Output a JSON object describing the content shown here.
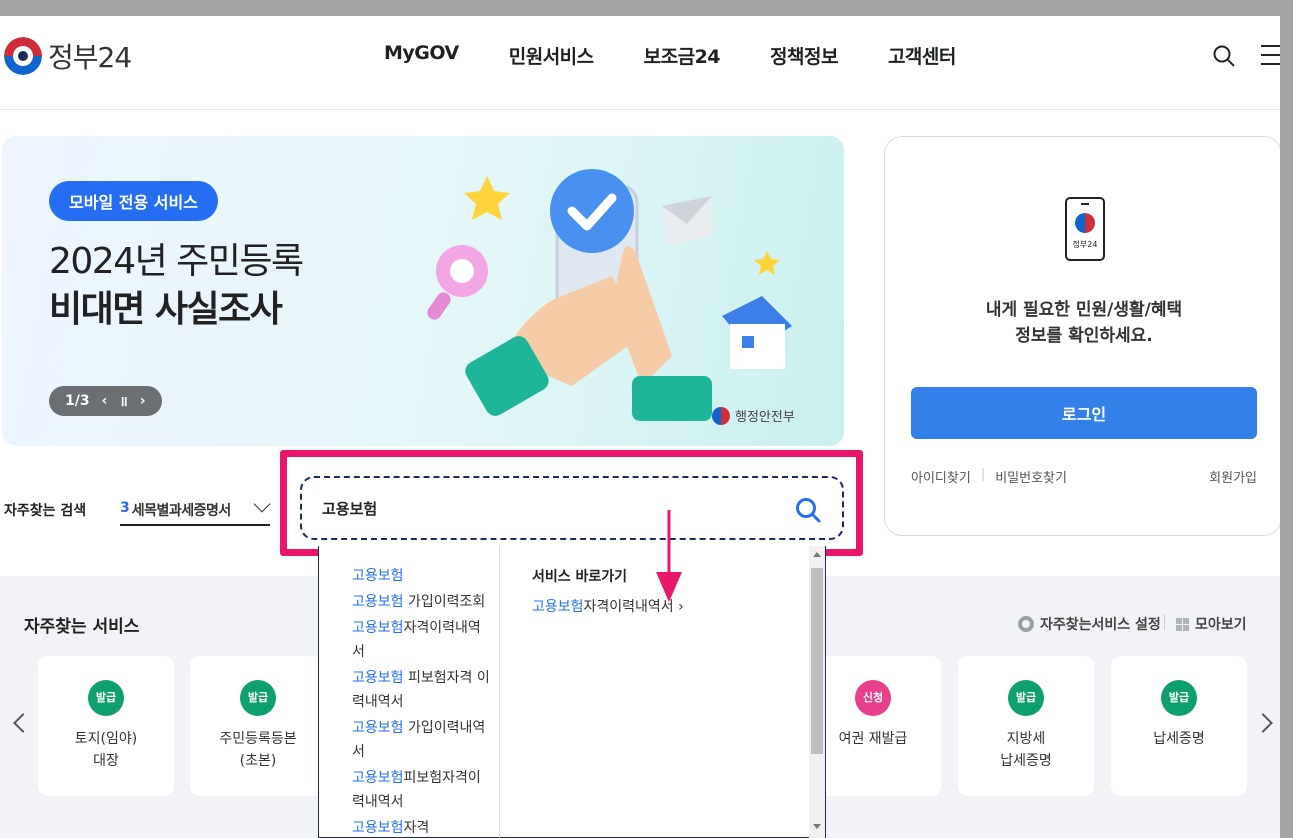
{
  "header": {
    "logo_text": "정부24",
    "nav": [
      "MyGOV",
      "민원서비스",
      "보조금24",
      "정책정보",
      "고객센터"
    ]
  },
  "banner": {
    "badge": "모바일 전용 서비스",
    "line1": "2024년 주민등록",
    "line2": "비대면 사실조사",
    "pager": "1/3",
    "ministry": "행정안전부"
  },
  "login": {
    "phone_label": "정부24",
    "message_l1": "내게 필요한 민원/생활/혜택",
    "message_l2": "정보를 확인하세요.",
    "button": "로그인",
    "find_id": "아이디찾기",
    "find_pw": "비밀번호찾기",
    "join": "회원가입"
  },
  "frequent_search": {
    "label": "자주찾는 검색",
    "rank": "3",
    "value": "세목별과세증명서"
  },
  "search": {
    "value": "고용보험"
  },
  "dropdown": {
    "keyword": "고용보험",
    "suggestions": [
      {
        "hl": "고용보험",
        "rest": ""
      },
      {
        "hl": "고용보험",
        "rest": " 가입이력조회"
      },
      {
        "hl": "고용보험",
        "rest": "자격이력내역서"
      },
      {
        "hl": "고용보험",
        "rest": " 피보험자격 이력내역서"
      },
      {
        "hl": "고용보험",
        "rest": " 가입이력내역서"
      },
      {
        "hl": "고용보험",
        "rest": "피보험자격이력내역서"
      },
      {
        "hl": "고용보험",
        "rest": "자격"
      }
    ],
    "shortcut_title": "서비스 바로가기",
    "shortcut_hl": "고용보험",
    "shortcut_rest": "자격이력내역서 ›"
  },
  "services": {
    "title": "자주찾는 서비스",
    "settings": "자주찾는서비스 설정",
    "view_all": "모아보기",
    "cards": [
      {
        "badge": "발급",
        "label": "토지(임야)\n대장"
      },
      {
        "badge": "발급",
        "label": "주민등록등본\n(초본)"
      },
      {
        "badge": "신청",
        "label": "여권 재발급"
      },
      {
        "badge": "발급",
        "label": "지방세\n납세증명"
      },
      {
        "badge": "발급",
        "label": "납세증명"
      }
    ]
  }
}
